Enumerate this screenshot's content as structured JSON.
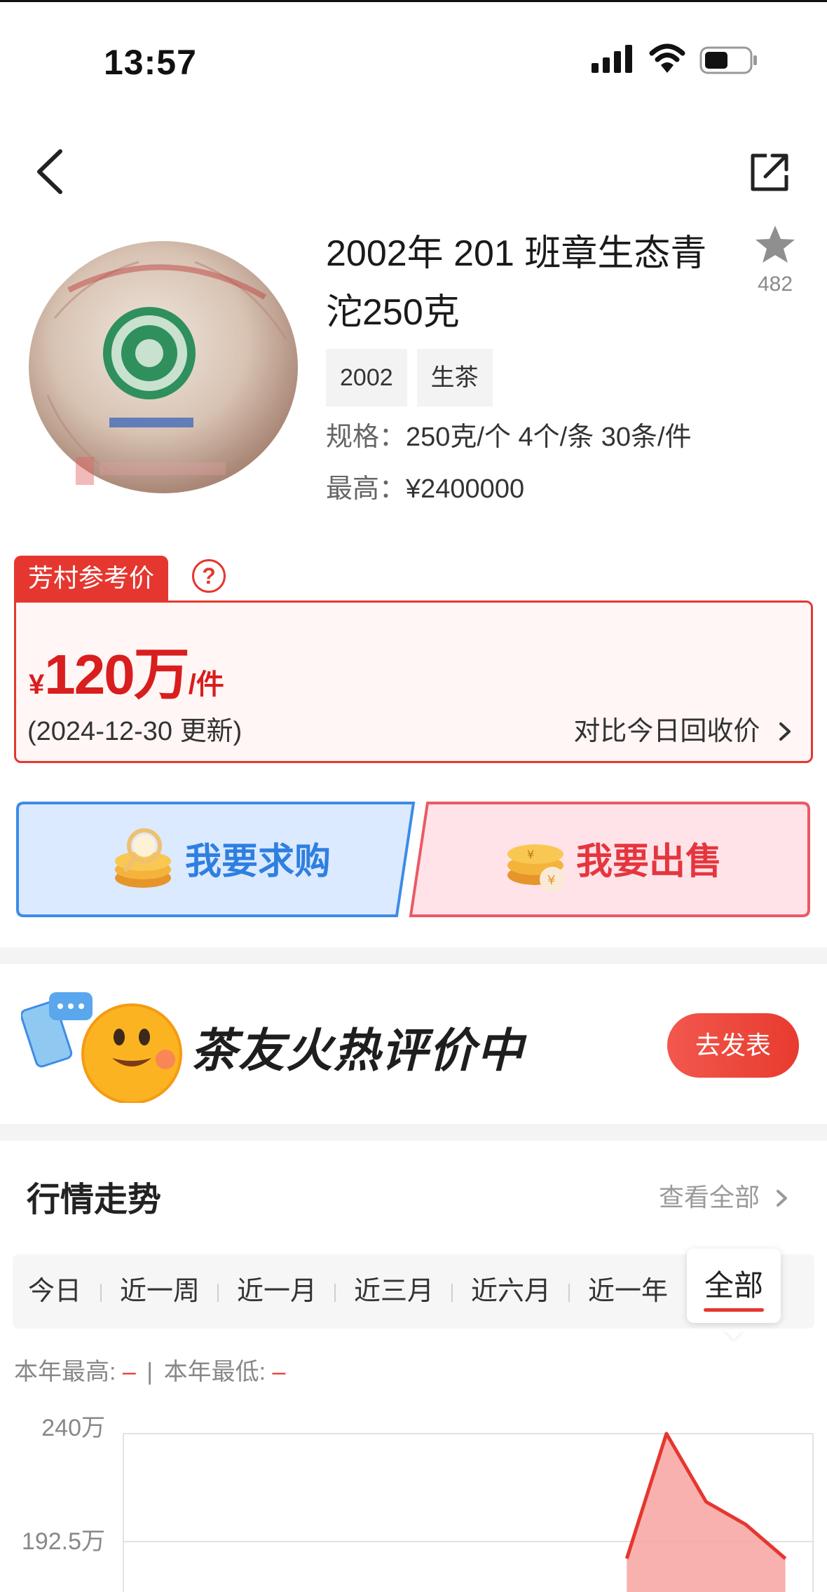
{
  "status_bar": {
    "time": "13:57"
  },
  "product": {
    "title": "2002年 201 班章生态青沱250克",
    "favorite_count": "482",
    "tags": [
      "2002",
      "生茶"
    ],
    "spec_label": "规格：",
    "spec_value": "250克/个 4个/条 30条/件",
    "highest_label": "最高：",
    "highest_value": "¥2400000"
  },
  "reference": {
    "tag": "芳村参考价",
    "help": "?",
    "currency": "¥",
    "price": "120万",
    "unit": "/件",
    "updated": "(2024-12-30 更新)",
    "compare": "对比今日回收价"
  },
  "actions": {
    "buy_label": "我要求购",
    "sell_label": "我要出售"
  },
  "banner": {
    "text": "茶友火热评价中",
    "button": "去发表"
  },
  "trend": {
    "title": "行情走势",
    "more": "查看全部",
    "periods": [
      "今日",
      "近一周",
      "近一月",
      "近三月",
      "近六月",
      "近一年",
      "全部"
    ],
    "active_period": "全部",
    "year_high_label": "本年最高:",
    "year_high_value": "–",
    "year_sep": "|",
    "year_low_label": "本年最低:",
    "year_low_value": "–"
  },
  "chart_data": {
    "type": "area",
    "y_ticks": [
      "240万",
      "192.5万"
    ],
    "ylim": [
      192.5,
      240
    ],
    "series": [
      {
        "values": [
          null,
          null,
          null,
          null,
          185,
          240,
          210,
          200,
          185
        ]
      }
    ],
    "colors": {
      "line": "#e5372f",
      "fill": "#f7a3a0"
    },
    "grid": true
  },
  "colors": {
    "accent": "#e5372f",
    "buy": "#2f7fe0",
    "sell": "#e5363f"
  }
}
